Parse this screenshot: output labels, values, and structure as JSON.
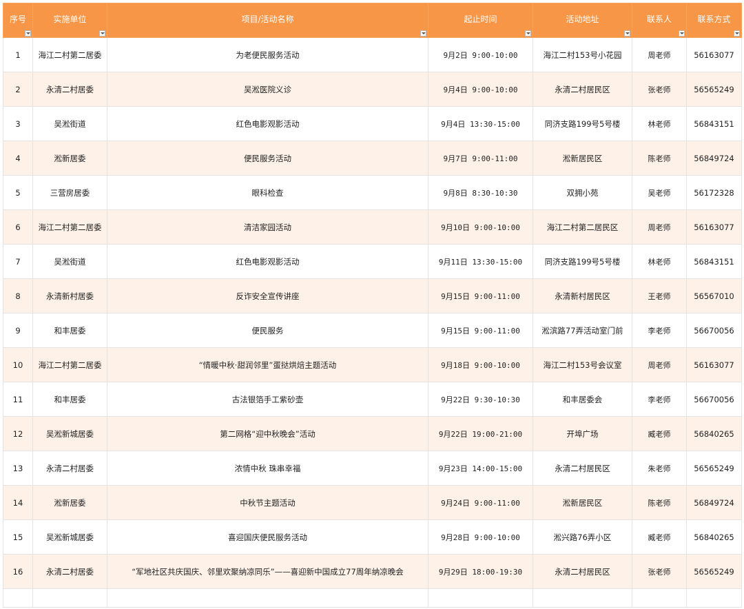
{
  "colors": {
    "header_bg": "#f79646",
    "header_text": "#ffffff",
    "row_alt_bg": "#fdf1e8",
    "grid": "#e3e3e3"
  },
  "table": {
    "headers": {
      "no": "序号",
      "unit": "实施单位",
      "name": "项目/活动名称",
      "time": "起止时间",
      "place": "活动地址",
      "contact": "联系人",
      "phone": "联系方式"
    },
    "filter_icon": "dropdown-filter-icon",
    "rows": [
      {
        "no": "1",
        "unit": "海江二村第二居委",
        "name": "为老便民服务活动",
        "time": "9月2日 9:00-10:00",
        "place": "海江二村153号小花园",
        "contact": "周老师",
        "phone": "56163077"
      },
      {
        "no": "2",
        "unit": "永清二村居委",
        "name": "吴淞医院义诊",
        "time": "9月4日 9:00-10:00",
        "place": "永清二村居民区",
        "contact": "张老师",
        "phone": "56565249"
      },
      {
        "no": "3",
        "unit": "吴淞街道",
        "name": "红色电影观影活动",
        "time": "9月4日 13:30-15:00",
        "place": "同济支路199号5号楼",
        "contact": "林老师",
        "phone": "56843151"
      },
      {
        "no": "4",
        "unit": "淞新居委",
        "name": "便民服务活动",
        "time": "9月7日 9:00-11:00",
        "place": "淞新居民区",
        "contact": "陈老师",
        "phone": "56849724"
      },
      {
        "no": "5",
        "unit": "三营房居委",
        "name": "眼科检查",
        "time": "9月8日 8:30-10:30",
        "place": "双拥小苑",
        "contact": "吴老师",
        "phone": "56172328"
      },
      {
        "no": "6",
        "unit": "海江二村第二居委",
        "name": "清洁家园活动",
        "time": "9月10日 9:00-10:00",
        "place": "海江二村第二居民区",
        "contact": "周老师",
        "phone": "56163077"
      },
      {
        "no": "7",
        "unit": "吴淞街道",
        "name": "红色电影观影活动",
        "time": "9月11日 13:30-15:00",
        "place": "同济支路199号5号楼",
        "contact": "林老师",
        "phone": "56843151"
      },
      {
        "no": "8",
        "unit": "永清新村居委",
        "name": "反诈安全宣传讲座",
        "time": "9月15日 9:00-11:00",
        "place": "永清新村居民区",
        "contact": "王老师",
        "phone": "56567010"
      },
      {
        "no": "9",
        "unit": "和丰居委",
        "name": "便民服务",
        "time": "9月15日 9:00-11:00",
        "place": "淞滨路77弄活动室门前",
        "contact": "李老师",
        "phone": "56670056"
      },
      {
        "no": "10",
        "unit": "海江二村第二居委",
        "name": "“情暖中秋·甜润邻里”蛋挞烘焙主题活动",
        "time": "9月18日 9:00-10:00",
        "place": "海江二村153号会议室",
        "contact": "周老师",
        "phone": "56163077"
      },
      {
        "no": "11",
        "unit": "和丰居委",
        "name": "古法银箔手工紫砂壶",
        "time": "9月22日 9:30-10:30",
        "place": "和丰居委会",
        "contact": "李老师",
        "phone": "56670056"
      },
      {
        "no": "12",
        "unit": "吴淞新城居委",
        "name": "第二网格“迎中秋晚会”活动",
        "time": "9月22日 19:00-21:00",
        "place": "开埠广场",
        "contact": "臧老师",
        "phone": "56840265"
      },
      {
        "no": "13",
        "unit": "永清二村居委",
        "name": "浓情中秋 珠串幸福",
        "time": "9月23日 14:00-15:00",
        "place": "永清二村居民区",
        "contact": "朱老师",
        "phone": "56565249"
      },
      {
        "no": "14",
        "unit": "淞新居委",
        "name": "中秋节主题活动",
        "time": "9月24日 9:00-11:00",
        "place": "淞新居民区",
        "contact": "陈老师",
        "phone": "56849724"
      },
      {
        "no": "15",
        "unit": "吴淞新城居委",
        "name": "喜迎国庆便民服务活动",
        "time": "9月28日 9:00-10:00",
        "place": "淞兴路76弄小区",
        "contact": "臧老师",
        "phone": "56840265"
      },
      {
        "no": "16",
        "unit": "永清二村居委",
        "name": "“军地社区共庆国庆、邻里欢聚纳凉同乐”——喜迎新中国成立77周年纳凉晚会",
        "time": "9月29日 18:00-19:30",
        "place": "永清二村居民区",
        "contact": "张老师",
        "phone": "56565249"
      }
    ]
  }
}
